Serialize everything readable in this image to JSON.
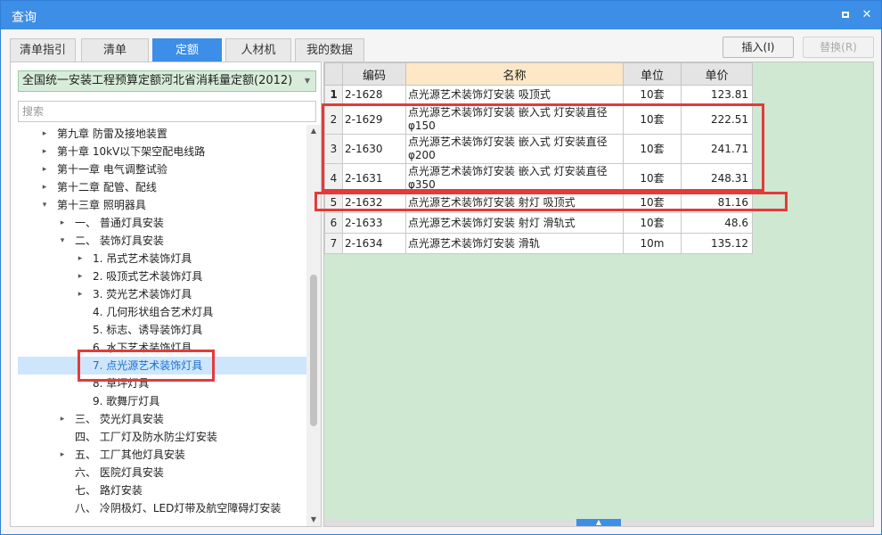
{
  "window": {
    "title": "查询",
    "min_icon": "minimize-icon",
    "close_glyph": "✕"
  },
  "tabs": [
    {
      "label": "清单指引",
      "active": false
    },
    {
      "label": "清单",
      "active": false
    },
    {
      "label": "定额",
      "active": true
    },
    {
      "label": "人材机",
      "active": false
    },
    {
      "label": "我的数据",
      "active": false
    }
  ],
  "buttons": {
    "insert": "插入(I)",
    "replace": "替换(R)"
  },
  "left": {
    "library": "全国统一安装工程预算定额河北省消耗量定额(2012)",
    "search_placeholder": "搜索",
    "tree": [
      {
        "label": "第九章 防雷及接地装置",
        "toggle": "▸"
      },
      {
        "label": "第十章 10kV以下架空配电线路",
        "toggle": "▸"
      },
      {
        "label": "第十一章 电气调整试验",
        "toggle": "▸"
      },
      {
        "label": "第十二章 配管、配线",
        "toggle": "▸"
      },
      {
        "label": "第十三章 照明器具",
        "toggle": "▾"
      },
      {
        "label": "一、 普通灯具安装",
        "toggle": "▸"
      },
      {
        "label": "二、 装饰灯具安装",
        "toggle": "▾"
      },
      {
        "label": "1. 吊式艺术装饰灯具",
        "toggle": "▸"
      },
      {
        "label": "2. 吸顶式艺术装饰灯具",
        "toggle": "▸"
      },
      {
        "label": "3. 荧光艺术装饰灯具",
        "toggle": "▸"
      },
      {
        "label": "4. 几何形状组合艺术灯具",
        "toggle": ""
      },
      {
        "label": "5. 标志、诱导装饰灯具",
        "toggle": ""
      },
      {
        "label": "6. 水下艺术装饰灯具",
        "toggle": ""
      },
      {
        "label": "7. 点光源艺术装饰灯具",
        "toggle": ""
      },
      {
        "label": "8. 草坪灯具",
        "toggle": ""
      },
      {
        "label": "9. 歌舞厅灯具",
        "toggle": ""
      },
      {
        "label": "三、 荧光灯具安装",
        "toggle": "▸"
      },
      {
        "label": "四、 工厂灯及防水防尘灯安装",
        "toggle": ""
      },
      {
        "label": "五、 工厂其他灯具安装",
        "toggle": "▸"
      },
      {
        "label": "六、 医院灯具安装",
        "toggle": ""
      },
      {
        "label": "七、 路灯安装",
        "toggle": ""
      },
      {
        "label": "八、 冷阴极灯、LED灯带及航空障碍灯安装",
        "toggle": ""
      }
    ],
    "scroll_up": "▲",
    "scroll_down": "▼"
  },
  "grid": {
    "headers": {
      "code": "编码",
      "name": "名称",
      "unit": "单位",
      "price": "单价"
    },
    "rows": [
      {
        "n": "1",
        "code": "2-1628",
        "name": "点光源艺术装饰灯安装 吸顶式",
        "unit": "10套",
        "price": "123.81"
      },
      {
        "n": "2",
        "code": "2-1629",
        "name": "点光源艺术装饰灯安装 嵌入式 灯安装直径φ150",
        "unit": "10套",
        "price": "222.51"
      },
      {
        "n": "3",
        "code": "2-1630",
        "name": "点光源艺术装饰灯安装 嵌入式 灯安装直径φ200",
        "unit": "10套",
        "price": "241.71"
      },
      {
        "n": "4",
        "code": "2-1631",
        "name": "点光源艺术装饰灯安装 嵌入式 灯安装直径φ350",
        "unit": "10套",
        "price": "248.31"
      },
      {
        "n": "5",
        "code": "2-1632",
        "name": "点光源艺术装饰灯安装 射灯 吸顶式",
        "unit": "10套",
        "price": "81.16"
      },
      {
        "n": "6",
        "code": "2-1633",
        "name": "点光源艺术装饰灯安装 射灯 滑轨式",
        "unit": "10套",
        "price": "48.6"
      },
      {
        "n": "7",
        "code": "2-1634",
        "name": "点光源艺术装饰灯安装 滑轨",
        "unit": "10m",
        "price": "135.12"
      }
    ],
    "grip_glyph": "▲"
  },
  "colors": {
    "accent": "#3d8ee6",
    "highlight_box": "#e43a3a",
    "library_bg": "#d7ecd9",
    "grid_empty_bg": "#cfe8d2",
    "name_header_bg": "#fde7c6"
  }
}
